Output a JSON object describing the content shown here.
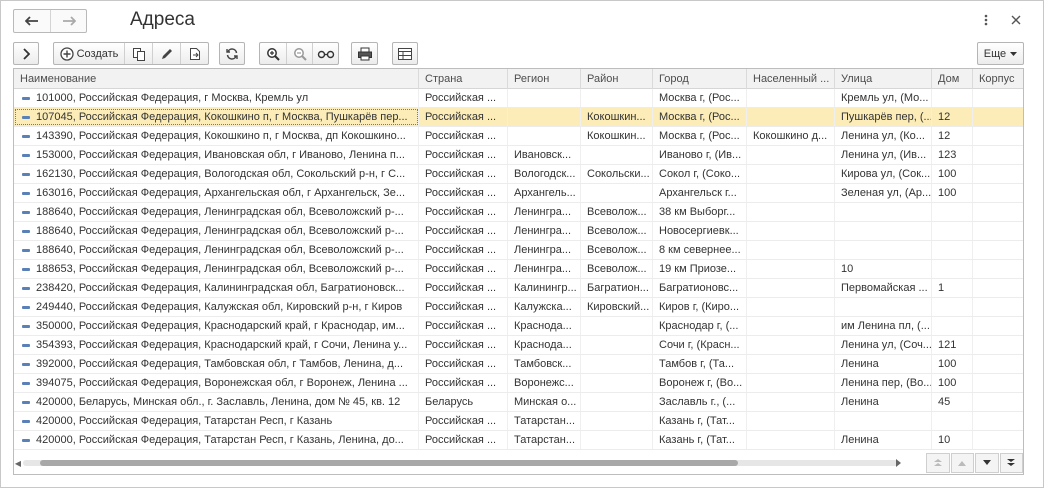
{
  "window": {
    "title": "Адреса"
  },
  "toolbar": {
    "create_label": "Создать",
    "more_label": "Еще"
  },
  "colors": {
    "selected_row": "#fbecb8",
    "header_bg": "#f2f2f2",
    "accent": "#5a80b8"
  },
  "table": {
    "columns": [
      "Наименование",
      "Страна",
      "Регион",
      "Район",
      "Город",
      "Населенный ...",
      "Улица",
      "Дом",
      "Корпус"
    ],
    "selected_index": 1,
    "rows": [
      [
        "101000, Российская Федерация, г Москва, Кремль ул",
        "Российская ...",
        "",
        "",
        "Москва г, (Рос...",
        "",
        "Кремль ул, (Мо...",
        "",
        ""
      ],
      [
        "107045, Российская Федерация, Кокошкино п, г Москва, Пушкарёв пер...",
        "Российская ...",
        "",
        "Кокошкин...",
        "Москва г, (Рос...",
        "",
        "Пушкарёв пер, (...",
        "12",
        ""
      ],
      [
        "143390, Российская Федерация, Кокошкино п, г Москва, дп Кокошкино...",
        "Российская ...",
        "",
        "Кокошкин...",
        "Москва г, (Рос...",
        "Кокошкино д...",
        "Ленина ул, (Ко...",
        "12",
        ""
      ],
      [
        "153000, Российская Федерация, Ивановская обл, г Иваново, Ленина п...",
        "Российская ...",
        "Ивановск...",
        "",
        "Иваново г, (Ив...",
        "",
        "Ленина ул, (Ив...",
        "123",
        ""
      ],
      [
        "162130, Российская Федерация, Вологодская обл, Сокольский р-н, г С...",
        "Российская ...",
        "Вологодск...",
        "Сокольски...",
        "Сокол г, (Соко...",
        "",
        "Кирова ул, (Сок...",
        "100",
        ""
      ],
      [
        "163016, Российская Федерация, Архангельская обл, г Архангельск, Зе...",
        "Российская ...",
        "Архангель...",
        "",
        "Архангельск г...",
        "",
        "Зеленая ул, (Ар...",
        "100",
        ""
      ],
      [
        "188640, Российская Федерация, Ленинградская обл, Всеволожский р-...",
        "Российская ...",
        "Ленингра...",
        "Всеволож...",
        "38 км Выборг...",
        "",
        "",
        "",
        ""
      ],
      [
        "188640, Российская Федерация, Ленинградская обл, Всеволожский р-...",
        "Российская ...",
        "Ленингра...",
        "Всеволож...",
        "Новосергиевк...",
        "",
        "",
        "",
        ""
      ],
      [
        "188640, Российская Федерация, Ленинградская обл, Всеволожский р-...",
        "Российская ...",
        "Ленингра...",
        "Всеволож...",
        "8 км севернее...",
        "",
        "",
        "",
        ""
      ],
      [
        "188653, Российская Федерация, Ленинградская обл, Всеволожский р-...",
        "Российская ...",
        "Ленингра...",
        "Всеволож...",
        "19 км Приозе...",
        "",
        "10",
        "",
        ""
      ],
      [
        "238420, Российская Федерация, Калининградская обл, Багратионовск...",
        "Российская ...",
        "Калинингр...",
        "Багратион...",
        "Багратионовс...",
        "",
        "Первомайская ...",
        "1",
        ""
      ],
      [
        "249440, Российская Федерация, Калужская обл, Кировский р-н, г Киров",
        "Российская ...",
        "Калужска...",
        "Кировский...",
        "Киров г, (Киро...",
        "",
        "",
        "",
        ""
      ],
      [
        "350000, Российская Федерация, Краснодарский край, г Краснодар, им...",
        "Российская ...",
        "Краснода...",
        "",
        "Краснодар г, (...",
        "",
        "им Ленина пл, (...",
        "",
        ""
      ],
      [
        "354393, Российская Федерация, Краснодарский край, г Сочи, Ленина у...",
        "Российская ...",
        "Краснода...",
        "",
        "Сочи г, (Красн...",
        "",
        "Ленина ул, (Соч...",
        "121",
        ""
      ],
      [
        "392000, Российская Федерация, Тамбовская обл, г Тамбов, Ленина, д...",
        "Российская ...",
        "Тамбовск...",
        "",
        "Тамбов г, (Та...",
        "",
        "Ленина",
        "100",
        ""
      ],
      [
        "394075, Российская Федерация, Воронежская обл, г Воронеж, Ленина ...",
        "Российская ...",
        "Воронежс...",
        "",
        "Воронеж г, (Во...",
        "",
        "Ленина пер, (Во...",
        "100",
        ""
      ],
      [
        "420000, Беларусь, Минская обл., г. Заславль, Ленина, дом № 45, кв. 12",
        "Беларусь",
        "Минская о...",
        "",
        "Заславль г., (...",
        "",
        "Ленина",
        "45",
        ""
      ],
      [
        "420000, Российская Федерация, Татарстан Респ, г Казань",
        "Российская ...",
        "Татарстан...",
        "",
        "Казань г, (Тат...",
        "",
        "",
        "",
        ""
      ],
      [
        "420000, Российская Федерация, Татарстан Респ, г Казань, Ленина, до...",
        "Российская ...",
        "Татарстан...",
        "",
        "Казань г, (Тат...",
        "",
        "Ленина",
        "10",
        ""
      ]
    ]
  }
}
